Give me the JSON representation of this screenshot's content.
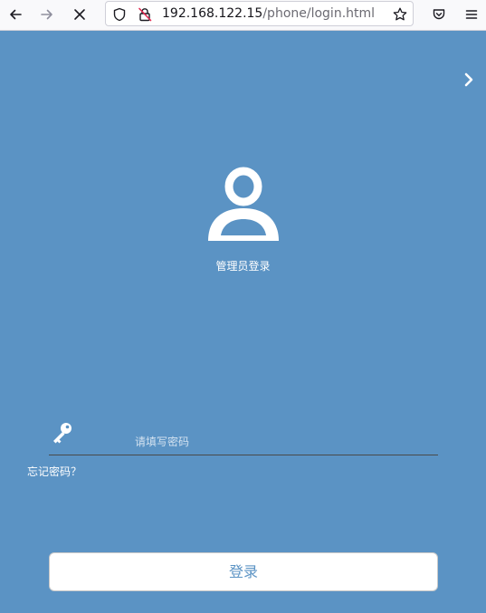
{
  "browser": {
    "url_host": "192.168.122.15",
    "url_path": "/phone/login.html",
    "icons": [
      "back-arrow-icon",
      "forward-arrow-icon",
      "stop-loading-icon",
      "shield-icon",
      "insecure-lock-icon",
      "bookmark-star-icon",
      "pocket-icon",
      "menu-icon"
    ]
  },
  "page": {
    "title": "管理员登录",
    "password_placeholder": "请填写密码",
    "forgot_label": "忘记密码？",
    "login_label": "登录",
    "background_color": "#5b93c4"
  }
}
